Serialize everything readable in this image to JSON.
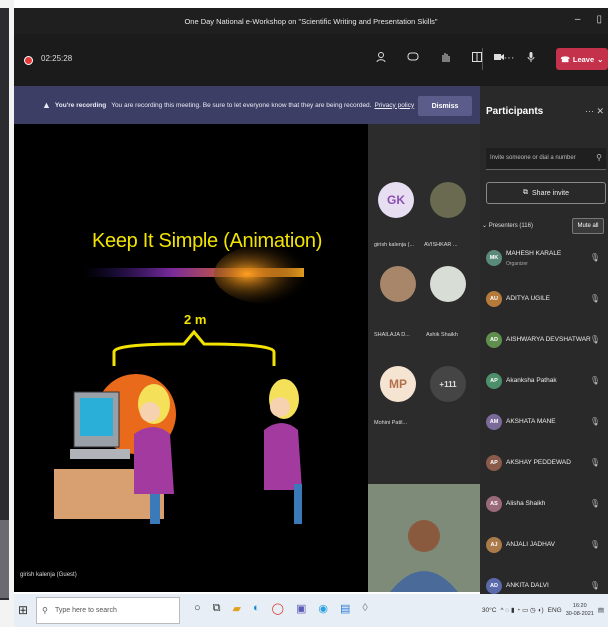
{
  "window": {
    "title": "One Day National e-Workshop on \"Scientific Writing and Presentation Skills\"",
    "minimize": "–",
    "restore": "▯"
  },
  "toolbar": {
    "timer": "02:25:28",
    "leave_label": "Leave",
    "icons": [
      "people-icon",
      "chat-icon",
      "hand-icon",
      "rooms-icon",
      "more-icon"
    ],
    "icons2": [
      "camera-icon",
      "mic-icon",
      "share-icon"
    ]
  },
  "banner": {
    "bold": "You're recording",
    "text": "You are recording this meeting. Be sure to let everyone know that they are being recorded.",
    "link": "Privacy policy",
    "dismiss": "Dismiss"
  },
  "slide": {
    "title": "Keep It Simple (Animation)",
    "distance_label": "2 m"
  },
  "stage": {
    "presenter_name": "girish kalenja (Guest)"
  },
  "gallery": {
    "tiles": [
      {
        "initials": "GK",
        "label": "girish kalenja (...",
        "color": "#e7dff1",
        "fg": "#8a4fb3"
      },
      {
        "initials": "",
        "label": "AVISHKAR ...",
        "color": "#6a6a50",
        "fg": "#fff"
      },
      {
        "initials": "",
        "label": "SHAILAJA D...",
        "color": "#a8866a",
        "fg": "#fff"
      },
      {
        "initials": "",
        "label": "Ashik Shaikh",
        "color": "#d8ddd6",
        "fg": "#fff"
      },
      {
        "initials": "MP",
        "label": "Mohini Patil...",
        "color": "#f6e4d2",
        "fg": "#b3714a"
      },
      {
        "initials": "+111",
        "label": "",
        "color": "#454545",
        "fg": "#ddd"
      }
    ]
  },
  "panel": {
    "title": "Participants",
    "controls": "···  ✕",
    "invite_placeholder": "Invite someone or dial a number",
    "share_invite": "Share invite",
    "presenters_header": "Presenters (116)",
    "mute_all": "Mute all",
    "participants": [
      {
        "initials": "MK",
        "name": "MAHESH KARALE",
        "role": "Organizer",
        "color": "#5a8a7a"
      },
      {
        "initials": "AU",
        "name": "ADITYA UGILE",
        "role": "",
        "color": "#b57a3a"
      },
      {
        "initials": "AD",
        "name": "AISHWARYA DEVSHATWAR",
        "role": "",
        "color": "#5f8f4c"
      },
      {
        "initials": "AP",
        "name": "Akanksha Pathak",
        "role": "",
        "color": "#4c8f6a"
      },
      {
        "initials": "AM",
        "name": "AKSHATA MANE",
        "role": "",
        "color": "#7a6a9a"
      },
      {
        "initials": "AP",
        "name": "AKSHAY PEDDEWAD",
        "role": "",
        "color": "#8a5a4a"
      },
      {
        "initials": "AS",
        "name": "Alisha Shaikh",
        "role": "",
        "color": "#9a6a7a"
      },
      {
        "initials": "AJ",
        "name": "ANJALI JADHAV",
        "role": "",
        "color": "#aa7a4a"
      },
      {
        "initials": "AD",
        "name": "ANKITA DALVI",
        "role": "",
        "color": "#5a6aaa"
      }
    ]
  },
  "taskbar": {
    "search_placeholder": "Type here to search",
    "weather": "30°C",
    "lang": "ENG",
    "time": "16:20",
    "date": "30-08-2021"
  },
  "colors": {
    "accent_leave": "#c4314b",
    "banner": "#3d3e66",
    "slide_text": "#f2e400"
  }
}
